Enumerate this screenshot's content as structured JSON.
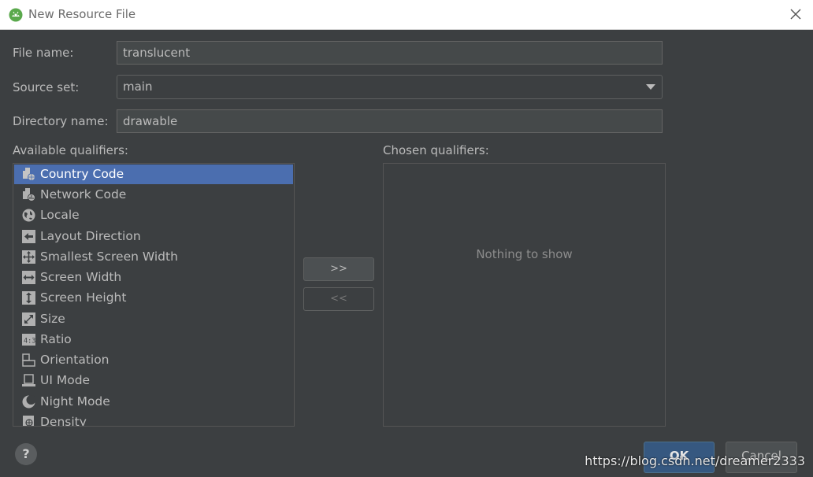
{
  "window": {
    "title": "New Resource File"
  },
  "form": {
    "file_name_label": "File name:",
    "file_name_value": "translucent",
    "source_set_label": "Source set:",
    "source_set_value": "main",
    "directory_name_label": "Directory name:",
    "directory_name_value": "drawable"
  },
  "qualifiers": {
    "available_label": "Available qualifiers:",
    "chosen_label": "Chosen qualifiers:",
    "available": [
      {
        "label": "Country Code",
        "icon": "country-code-icon",
        "selected": true
      },
      {
        "label": "Network Code",
        "icon": "network-code-icon"
      },
      {
        "label": "Locale",
        "icon": "globe-icon"
      },
      {
        "label": "Layout Direction",
        "icon": "layout-direction-icon"
      },
      {
        "label": "Smallest Screen Width",
        "icon": "smallest-screen-width-icon"
      },
      {
        "label": "Screen Width",
        "icon": "screen-width-icon"
      },
      {
        "label": "Screen Height",
        "icon": "screen-height-icon"
      },
      {
        "label": "Size",
        "icon": "size-icon"
      },
      {
        "label": "Ratio",
        "icon": "ratio-icon"
      },
      {
        "label": "Orientation",
        "icon": "orientation-icon"
      },
      {
        "label": "UI Mode",
        "icon": "ui-mode-icon"
      },
      {
        "label": "Night Mode",
        "icon": "night-mode-icon"
      },
      {
        "label": "Density",
        "icon": "density-icon"
      }
    ],
    "add_button": ">>",
    "remove_button": "<<",
    "empty_text": "Nothing to show"
  },
  "buttons": {
    "help": "?",
    "ok": "OK",
    "cancel": "Cancel"
  },
  "watermark": "https://blog.csdn.net/dreamer2333",
  "colors": {
    "selection": "#4b6eaf",
    "background": "#3c3f41",
    "ok_button": "#365880"
  }
}
